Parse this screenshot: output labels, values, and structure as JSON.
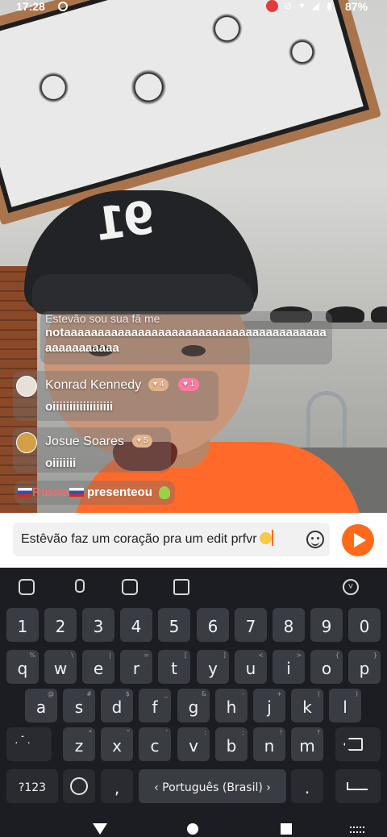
{
  "status_bar": {
    "time": "17:28",
    "battery": "87%",
    "icons": "▾◢"
  },
  "comments": [
    {
      "preview": "Estevão  sou sua fã me",
      "message": "notaaaaaaaaaaaaaaaaaaaaaaaaaaaaaaaaaaaaaaaaaaaaaaaaaa"
    },
    {
      "username": "Konrad Kennedy",
      "level": "4",
      "fan_level": "1",
      "message": "oiiiiiiiiiiiiiiiiii"
    },
    {
      "username": "Josue Soares",
      "level": "5",
      "message": "oiiiiiii"
    }
  ],
  "gift": {
    "country": "Rússia",
    "action": "presenteou"
  },
  "input": {
    "text": "Estêvão faz um coração pra um edit prfvr"
  },
  "keyboard": {
    "numbers": [
      "1",
      "2",
      "3",
      "4",
      "5",
      "6",
      "7",
      "8",
      "9",
      "0"
    ],
    "row_q": [
      {
        "k": "q",
        "h": "%"
      },
      {
        "k": "w",
        "h": "\\"
      },
      {
        "k": "e",
        "h": "|"
      },
      {
        "k": "r",
        "h": "="
      },
      {
        "k": "t",
        "h": "["
      },
      {
        "k": "y",
        "h": "]"
      },
      {
        "k": "u",
        "h": "<"
      },
      {
        "k": "i",
        "h": ">"
      },
      {
        "k": "o",
        "h": "{"
      },
      {
        "k": "p",
        "h": "}"
      }
    ],
    "row_a": [
      {
        "k": "a",
        "h": "@"
      },
      {
        "k": "s",
        "h": "#"
      },
      {
        "k": "d",
        "h": "$"
      },
      {
        "k": "f",
        "h": "_"
      },
      {
        "k": "g",
        "h": "&"
      },
      {
        "k": "h",
        "h": "-"
      },
      {
        "k": "j",
        "h": "+"
      },
      {
        "k": "k",
        "h": "("
      },
      {
        "k": "l",
        "h": ")"
      }
    ],
    "row_z": [
      {
        "k": "z",
        "h": "*"
      },
      {
        "k": "x",
        "h": "\""
      },
      {
        "k": "c",
        "h": "'"
      },
      {
        "k": "v",
        "h": ":"
      },
      {
        "k": "b",
        "h": ";"
      },
      {
        "k": "n",
        "h": "!"
      },
      {
        "k": "m",
        "h": "?"
      }
    ],
    "symbols_label": "?123",
    "comma": ",",
    "space_label": "Português (Brasil)",
    "period": ".",
    "space_arrow_left": "‹",
    "space_arrow_right": "›"
  }
}
